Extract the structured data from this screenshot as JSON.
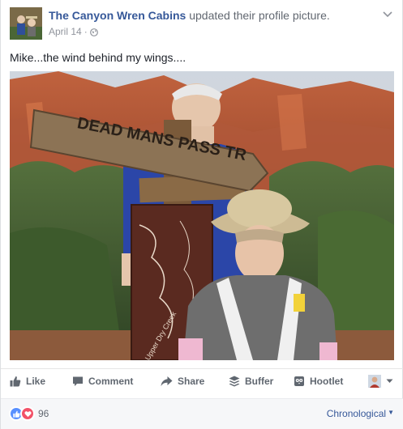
{
  "post": {
    "page_name": "The Canyon Wren Cabins",
    "action_text": "updated their profile picture.",
    "date": "April 14",
    "separator": "·",
    "text": "Mike...the wind behind my wings...."
  },
  "photo": {
    "sign_text": "DEAD MANS PASS TR",
    "trail_board_text": "Upper Dry Creek"
  },
  "actions": {
    "like": "Like",
    "comment": "Comment",
    "share": "Share",
    "buffer": "Buffer",
    "hootlet": "Hootlet"
  },
  "footer": {
    "reaction_count": "96",
    "sort_label": "Chronological"
  },
  "colors": {
    "link": "#365899",
    "muted": "#90949c",
    "like_blue": "#5890ff",
    "love_red": "#f25268"
  },
  "icons": [
    "globe-icon",
    "chevron-down-icon",
    "like-icon",
    "comment-icon",
    "share-icon",
    "buffer-icon",
    "hootlet-icon",
    "thumbs-up-icon",
    "heart-icon"
  ]
}
